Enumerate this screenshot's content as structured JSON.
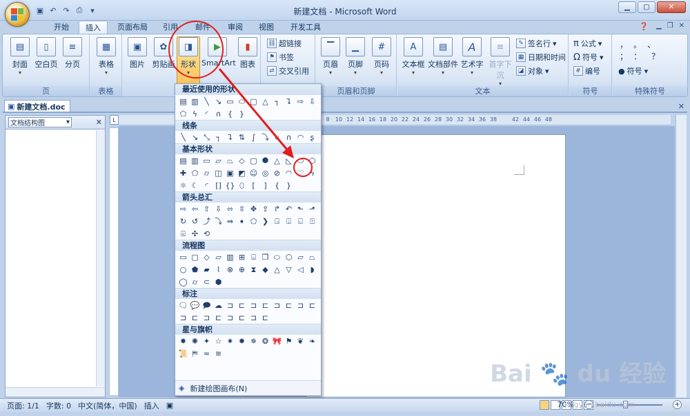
{
  "window": {
    "title": "新建文档 - Microsoft Word"
  },
  "tabs": [
    {
      "label": "开始",
      "active": false
    },
    {
      "label": "插入",
      "active": true
    },
    {
      "label": "页面布局",
      "active": false
    },
    {
      "label": "引用",
      "active": false
    },
    {
      "label": "邮件",
      "active": false
    },
    {
      "label": "审阅",
      "active": false
    },
    {
      "label": "视图",
      "active": false
    },
    {
      "label": "开发工具",
      "active": false
    }
  ],
  "ribbon": {
    "page_group": {
      "label": "页",
      "buttons": [
        "封面",
        "空白页",
        "分页"
      ]
    },
    "table_group": {
      "label": "表格",
      "buttons": [
        "表格"
      ]
    },
    "illustrations": {
      "buttons": [
        "图片",
        "剪贴画",
        "形状",
        "SmartArt",
        "图表"
      ]
    },
    "links": {
      "buttons": [
        "超链接",
        "书签",
        "交叉引用"
      ]
    },
    "header_footer": {
      "label": "页眉和页脚",
      "buttons": [
        "页眉",
        "页脚",
        "页码"
      ]
    },
    "text": {
      "label": "文本",
      "buttons": [
        "文本框",
        "文档部件",
        "艺术字",
        "首字下沉"
      ],
      "small": [
        "签名行",
        "日期和时间",
        "对象"
      ]
    },
    "symbols": {
      "label": "符号",
      "buttons": [
        "公式",
        "符号",
        "编号"
      ]
    },
    "special": {
      "label": "特殊符号",
      "button": "符号"
    }
  },
  "document_tab": {
    "name": "新建文档.doc"
  },
  "left_pane": {
    "selector": "文档结构图"
  },
  "gallery": {
    "sections": [
      "最近使用的形状",
      "线条",
      "基本形状",
      "箭头总汇",
      "流程图",
      "标注",
      "星与旗帜"
    ],
    "footer": "新建绘图画布(N)"
  },
  "status": {
    "page": "页面: 1/1",
    "words": "字数: 0",
    "language": "中文(简体，中国)",
    "mode": "插入",
    "zoom": "70%"
  },
  "ruler": {
    "marks": [
      "8",
      "10",
      "12",
      "14",
      "16",
      "18",
      "20",
      "22",
      "24",
      "26",
      "28",
      "30",
      "32",
      "34",
      "36",
      "38",
      "",
      "42",
      "44",
      "46",
      "48"
    ]
  },
  "watermark": {
    "brand": "Bai du 经验",
    "url": "jingyan.baidu.com"
  },
  "colors": {
    "accent": "#f8c45c",
    "annotation": "#e21d1d"
  }
}
